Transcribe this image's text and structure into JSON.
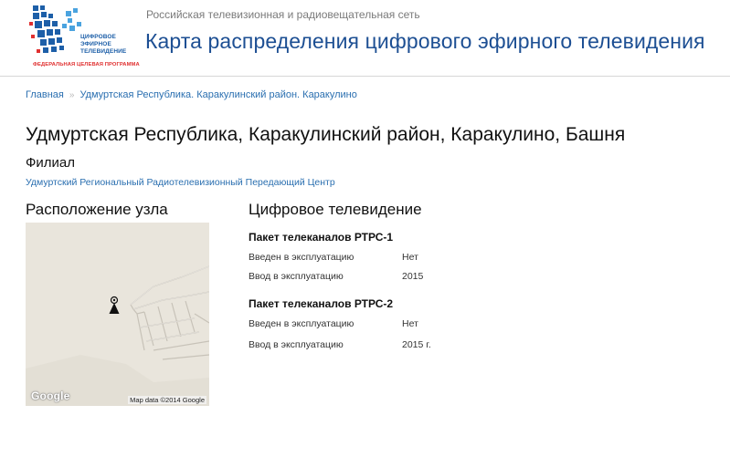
{
  "header": {
    "logo": {
      "line1": "ЦИФРОВОЕ",
      "line2": "ЭФИРНОЕ",
      "line3": "ТЕЛЕВИДЕНИЕ",
      "subtitle": "ФЕДЕРАЛЬНАЯ ЦЕЛЕВАЯ ПРОГРАММА"
    },
    "network": "Российская телевизионная и радиовещательная сеть",
    "title": "Карта распределения цифрового эфирного телевидения"
  },
  "breadcrumb": {
    "home": "Главная",
    "separator": "»",
    "current": "Удмуртская Республика. Каракулинский район. Каракулино"
  },
  "page": {
    "title": "Удмуртская Республика, Каракулинский район, Каракулино, Башня",
    "branch_label": "Филиал",
    "branch_link": "Удмуртский Региональный Радиотелевизионный Передающий Центр"
  },
  "location": {
    "heading": "Расположение узла",
    "map": {
      "google_logo": "Google",
      "attribution": "Map data ©2014 Google",
      "marker_icon": "radio-tower-icon"
    }
  },
  "digital_tv": {
    "heading": "Цифровое телевидение",
    "packages": [
      {
        "title": "Пакет телеканалов РТРС-1",
        "rows": [
          {
            "label": "Введен в эксплуатацию",
            "value": "Нет"
          },
          {
            "label": "Ввод в эксплуатацию",
            "value": "2015"
          }
        ]
      },
      {
        "title": "Пакет телеканалов РТРС-2",
        "rows": [
          {
            "label": "Введен в эксплуатацию",
            "value": "Нет"
          },
          {
            "label": "Ввод в эксплуатацию",
            "value": "2015 г."
          }
        ]
      }
    ]
  },
  "colors": {
    "brand_blue": "#1d4f93",
    "link_blue": "#2a6fb0",
    "logo_red": "#e03030",
    "map_background": "#e9e5dc"
  }
}
